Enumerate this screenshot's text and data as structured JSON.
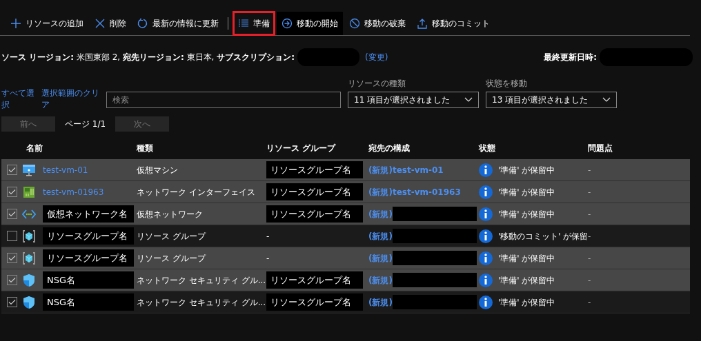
{
  "toolbar": [
    {
      "label": "リソースの追加",
      "kind": "add",
      "highlighted": false,
      "hover": false
    },
    {
      "label": "削除",
      "kind": "delete",
      "highlighted": false,
      "hover": false
    },
    {
      "label": "最新の情報に更新",
      "kind": "refresh",
      "highlighted": false,
      "hover": false
    },
    {
      "label": "準備",
      "kind": "prepare",
      "highlighted": true,
      "hover": false
    },
    {
      "label": "移動の開始",
      "kind": "start",
      "highlighted": false,
      "hover": true
    },
    {
      "label": "移動の破棄",
      "kind": "discard",
      "highlighted": false,
      "hover": false
    },
    {
      "label": "移動のコミット",
      "kind": "commit",
      "highlighted": false,
      "hover": false
    }
  ],
  "info": {
    "source_label": "ソース リージョン:",
    "source": "米国東部 2,",
    "target_label": "宛先リージョン:",
    "target": "東日本,",
    "subscription_label": "サブスクリプション:",
    "change_link": "(変更)",
    "updated_label": "最終更新日時:"
  },
  "filters": {
    "select_all": "すべて選択",
    "clear": "選択範囲のクリア",
    "search": {
      "placeholder": "検索"
    },
    "dropdowns": [
      {
        "label": "リソースの種類",
        "value": "11 項目が選択されました"
      },
      {
        "label": "状態を移動",
        "value": "13 項目が選択されました"
      }
    ]
  },
  "pager": {
    "prev": "前へ",
    "page": "ページ 1/1",
    "next": "次へ",
    "prev_disabled": true,
    "next_disabled": true
  },
  "table": {
    "columns": [
      "名前",
      "種類",
      "リソース グループ",
      "宛先の構成",
      "状態",
      "問題点"
    ],
    "rows": [
      {
        "kind": "vm",
        "checked": true,
        "highlighted": true,
        "name": {
          "text": "test-vm-01",
          "kind": "link"
        },
        "type": "仮想マシン",
        "group": {
          "text": "リソースグループ名",
          "kind": "masked"
        },
        "dest": {
          "text": "(新規)test-vm-01",
          "kind": "link"
        },
        "status": "'準備' が保留中",
        "issues": "-"
      },
      {
        "kind": "nic",
        "checked": true,
        "highlighted": true,
        "name": {
          "text": "test-vm-01963",
          "kind": "link"
        },
        "type": "ネットワーク インターフェイス",
        "group": {
          "text": "リソースグループ名",
          "kind": "masked"
        },
        "dest": {
          "text": "(新規)test-vm-01963",
          "kind": "link"
        },
        "status": "'準備' が保留中",
        "issues": "-"
      },
      {
        "kind": "vnet",
        "checked": true,
        "highlighted": true,
        "name": {
          "text": "仮想ネットワーク名",
          "kind": "masked"
        },
        "type": "仮想ネットワーク",
        "group": {
          "text": "リソースグループ名",
          "kind": "masked"
        },
        "dest": {
          "text": "(新規)",
          "kind": "redacted"
        },
        "status": "'準備' が保留中",
        "issues": "-"
      },
      {
        "kind": "resource-group",
        "checked": false,
        "highlighted": false,
        "name": {
          "text": "リソースグループ名",
          "kind": "masked"
        },
        "type": "リソース グループ",
        "group": {
          "text": "-",
          "kind": "plain"
        },
        "dest": {
          "text": "(新規)",
          "kind": "redacted"
        },
        "status": "'移動のコミット' が保留",
        "issues": "-"
      },
      {
        "kind": "resource-group",
        "checked": true,
        "highlighted": true,
        "name": {
          "text": "リソースグループ名",
          "kind": "masked"
        },
        "type": "リソース グループ",
        "group": {
          "text": "-",
          "kind": "plain"
        },
        "dest": {
          "text": "(新規)",
          "kind": "redacted"
        },
        "status": "'準備' が保留中",
        "issues": "-"
      },
      {
        "kind": "nsg",
        "checked": true,
        "highlighted": true,
        "name": {
          "text": "NSG名",
          "kind": "masked"
        },
        "type": "ネットワーク セキュリティ グル...",
        "group": {
          "text": "リソースグループ名",
          "kind": "masked"
        },
        "dest": {
          "text": "(新規)",
          "kind": "redacted"
        },
        "status": "'準備' が保留中",
        "issues": "-"
      },
      {
        "kind": "nsg",
        "checked": true,
        "highlighted": false,
        "name": {
          "text": "NSG名",
          "kind": "masked"
        },
        "type": "ネットワーク セキュリティ グル...",
        "group": {
          "text": "リソースグループ名",
          "kind": "masked"
        },
        "dest": {
          "text": "(新規)",
          "kind": "redacted"
        },
        "status": "'準備' が保留中",
        "issues": "-"
      }
    ]
  }
}
